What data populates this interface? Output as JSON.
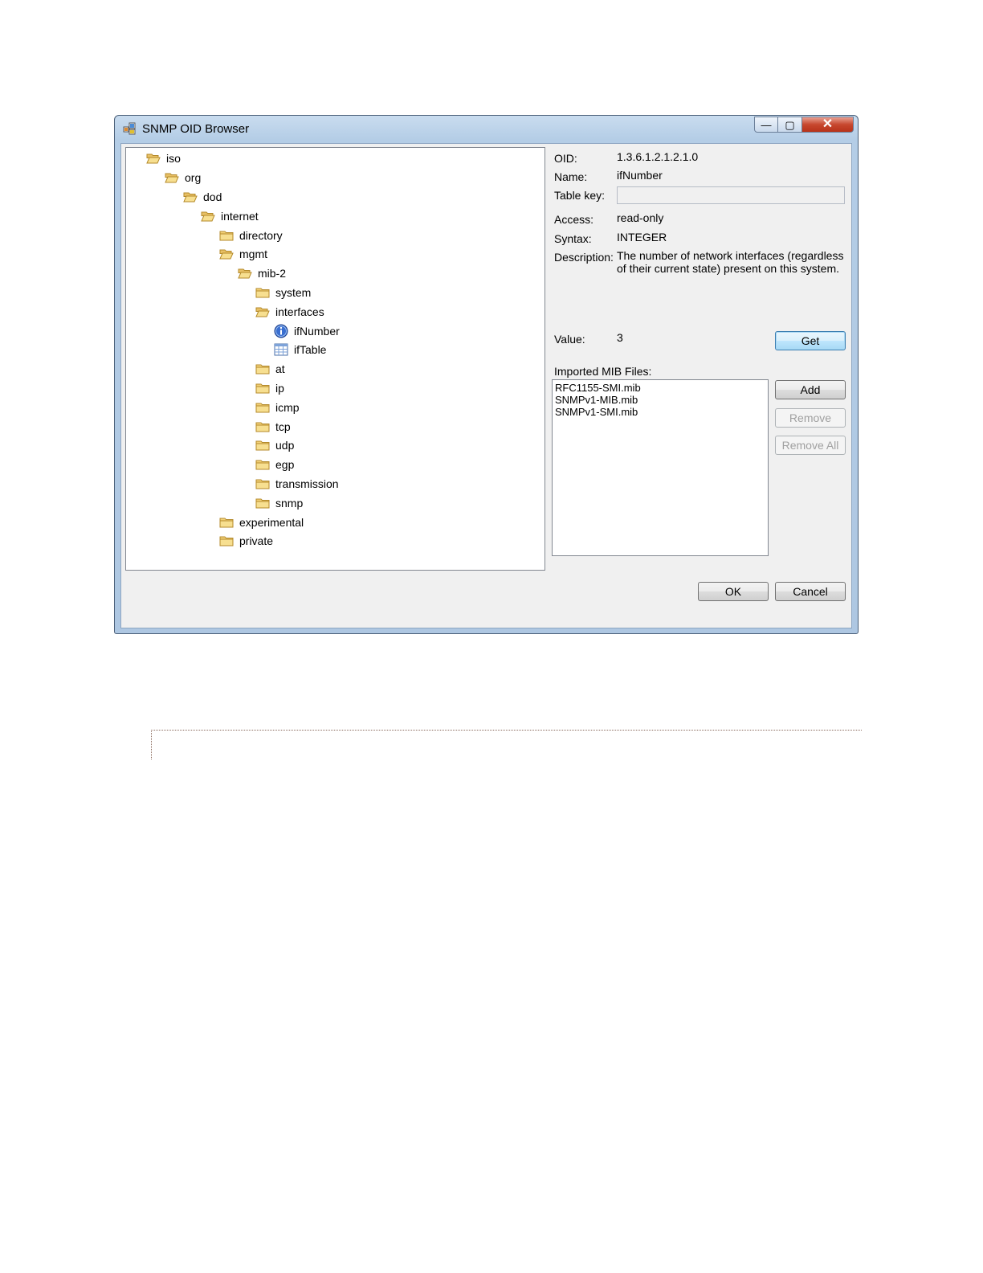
{
  "window": {
    "title": "SNMP OID Browser",
    "controls": {
      "minimize": "—",
      "maximize": "▢",
      "close": "✕"
    }
  },
  "tree": {
    "nodes": [
      {
        "label": "iso",
        "icon": "open-folder-icon"
      },
      {
        "label": "org",
        "icon": "open-folder-icon"
      },
      {
        "label": "dod",
        "icon": "open-folder-icon"
      },
      {
        "label": "internet",
        "icon": "open-folder-icon"
      },
      {
        "label": "directory",
        "icon": "folder-icon"
      },
      {
        "label": "mgmt",
        "icon": "open-folder-icon"
      },
      {
        "label": "mib-2",
        "icon": "open-folder-icon"
      },
      {
        "label": "system",
        "icon": "folder-icon"
      },
      {
        "label": "interfaces",
        "icon": "open-folder-icon"
      },
      {
        "label": "ifNumber",
        "icon": "info-icon"
      },
      {
        "label": "ifTable",
        "icon": "table-icon"
      },
      {
        "label": "at",
        "icon": "folder-icon"
      },
      {
        "label": "ip",
        "icon": "folder-icon"
      },
      {
        "label": "icmp",
        "icon": "folder-icon"
      },
      {
        "label": "tcp",
        "icon": "folder-icon"
      },
      {
        "label": "udp",
        "icon": "folder-icon"
      },
      {
        "label": "egp",
        "icon": "folder-icon"
      },
      {
        "label": "transmission",
        "icon": "folder-icon"
      },
      {
        "label": "snmp",
        "icon": "folder-icon"
      },
      {
        "label": "experimental",
        "icon": "folder-icon"
      },
      {
        "label": "private",
        "icon": "folder-icon"
      }
    ]
  },
  "details": {
    "oid_label": "OID:",
    "oid": "1.3.6.1.2.1.2.1.0",
    "name_label": "Name:",
    "name": "ifNumber",
    "table_key_label": "Table key:",
    "table_key": "",
    "access_label": "Access:",
    "access": "read-only",
    "syntax_label": "Syntax:",
    "syntax": "INTEGER",
    "description_label": "Description:",
    "description": "The number of network interfaces (regardless of their current state) present on this system.",
    "value_label": "Value:",
    "value": "3"
  },
  "buttons": {
    "get": "Get",
    "add": "Add",
    "remove": "Remove",
    "remove_all": "Remove All",
    "ok": "OK",
    "cancel": "Cancel"
  },
  "mib_files": {
    "label": "Imported MIB Files:",
    "items": [
      "RFC1155-SMI.mib",
      "SNMPv1-MIB.mib",
      "SNMPv1-SMI.mib"
    ]
  }
}
